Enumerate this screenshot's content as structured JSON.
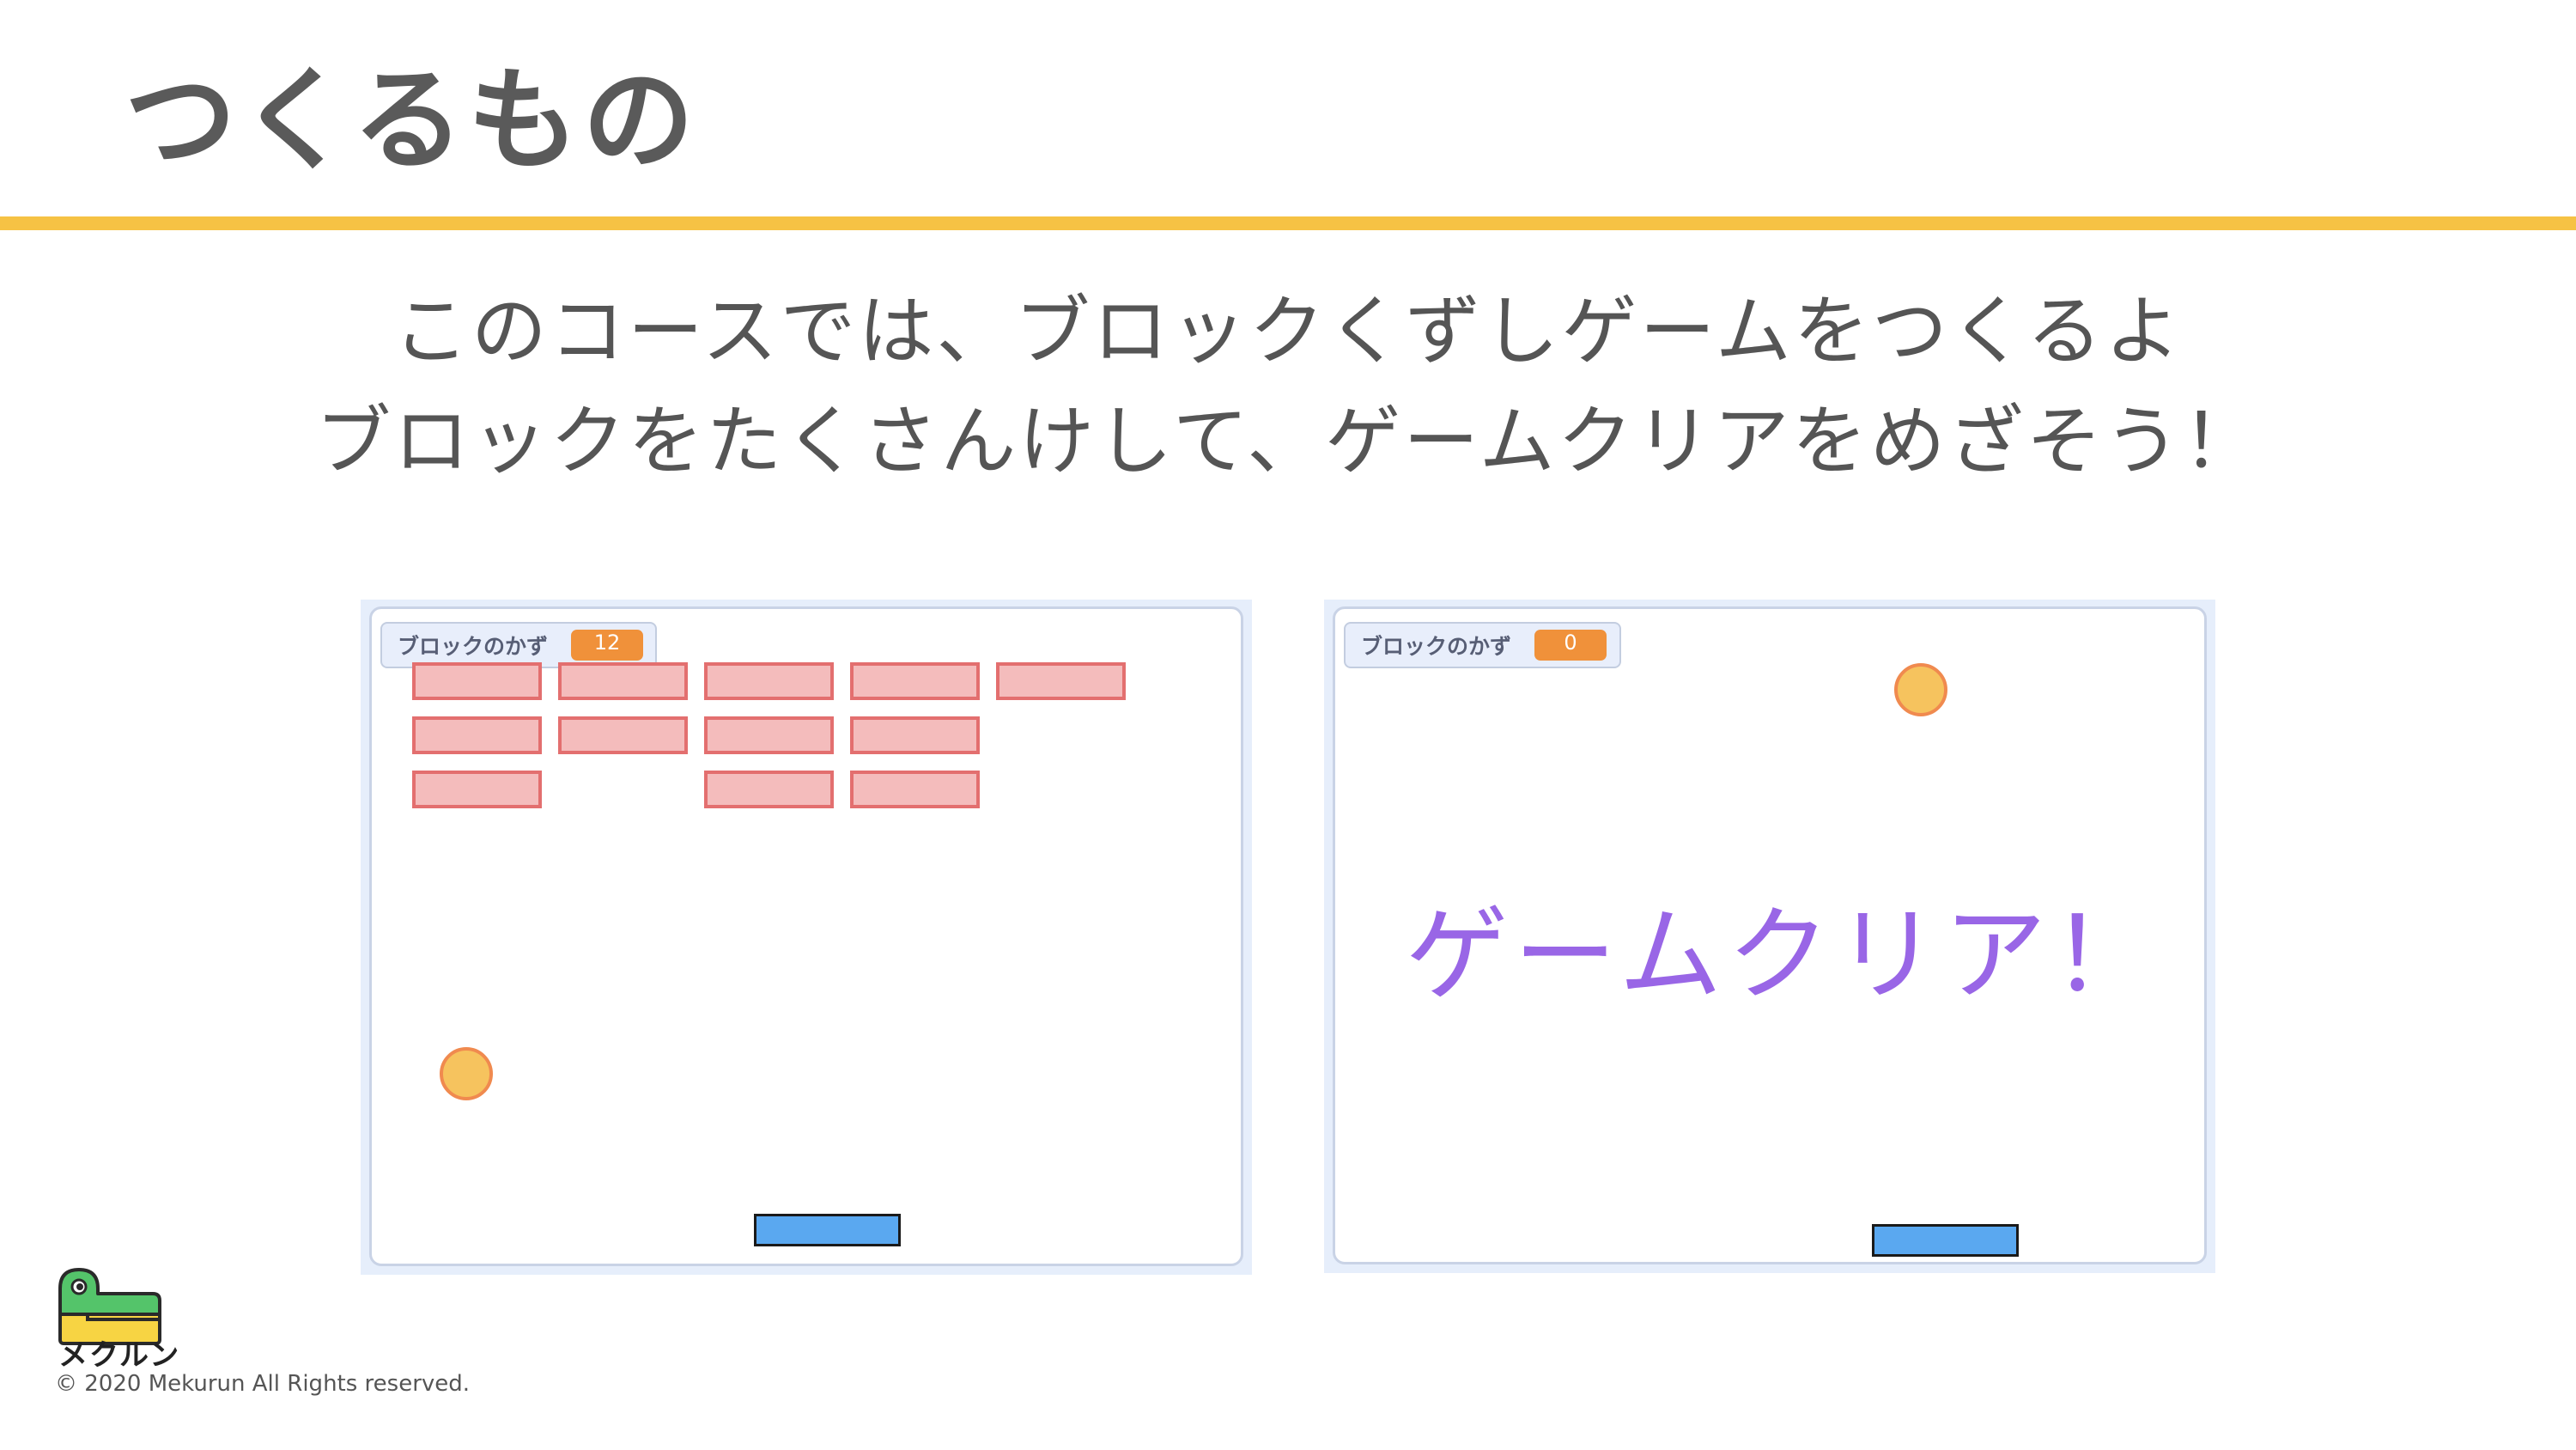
{
  "slide": {
    "title": "つくるもの",
    "intro_line_1": "このコースでは、ブロックくずしゲームをつくるよ",
    "intro_line_2": "ブロックをたくさんけして、ゲームクリアをめざそう！"
  },
  "colors": {
    "accent_rule": "#f6c244",
    "brick_fill": "#f4bcbc",
    "brick_border": "#e36f6f",
    "ball_fill": "#f6c35e",
    "paddle_fill": "#5aa8f0",
    "monitor_value_bg": "#f0913a",
    "clear_text": "#9966e6"
  },
  "stage_left": {
    "monitor_label": "ブロックのかず",
    "monitor_value": "12",
    "bricks_per_row": [
      5,
      4,
      3
    ],
    "total_bricks": 12
  },
  "stage_right": {
    "monitor_label": "ブロックのかず",
    "monitor_value": "0",
    "message": "ゲームクリア！"
  },
  "footer": {
    "logo_text": "メクルン",
    "copyright": "© 2020 Mekurun All Rights reserved."
  }
}
